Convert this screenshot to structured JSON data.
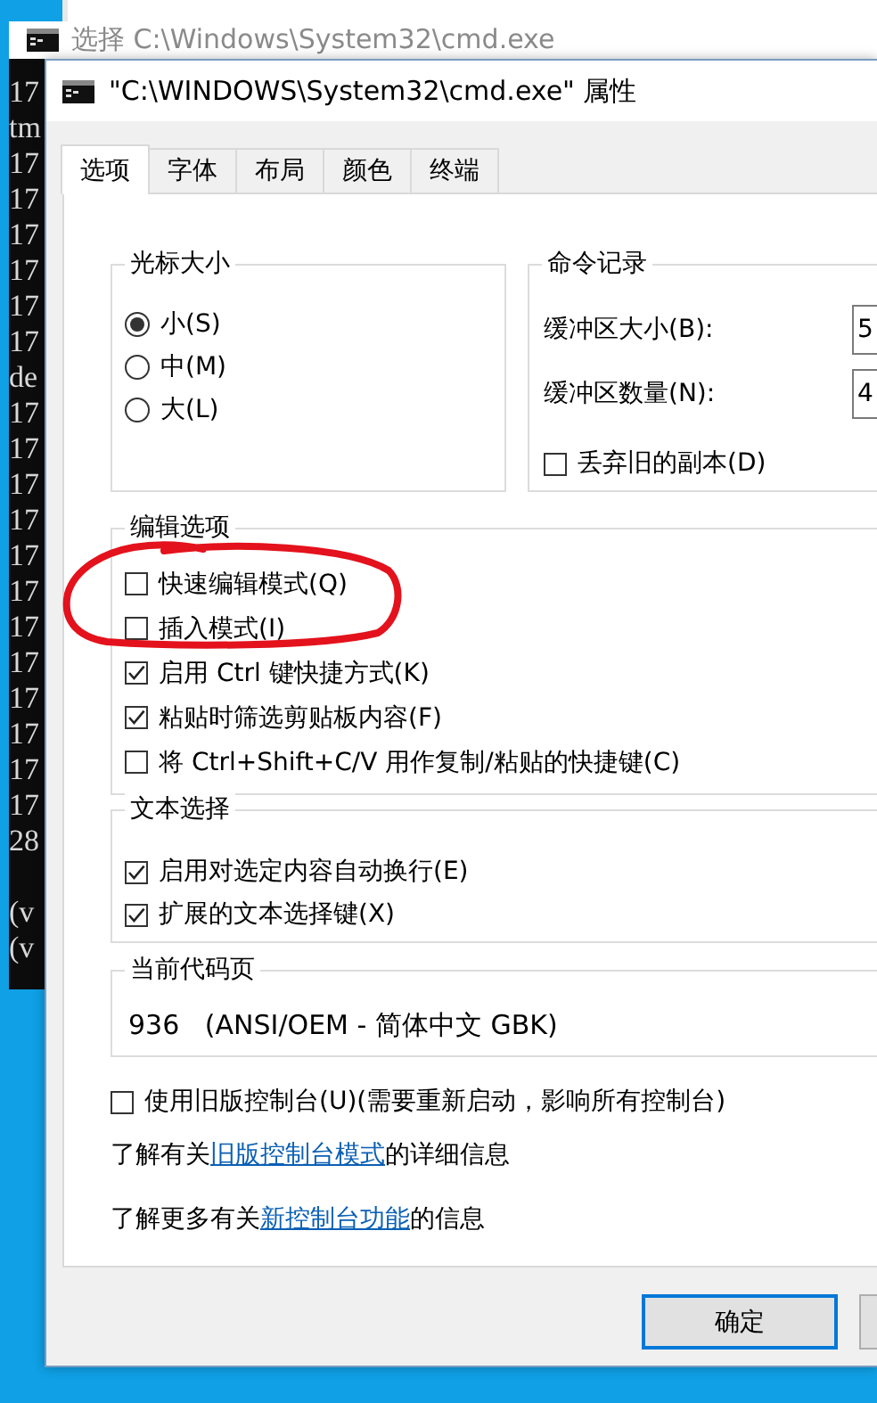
{
  "background_window": {
    "title": "选择 C:\\Windows\\System32\\cmd.exe",
    "lines": [
      "17",
      "tm",
      "17",
      "17",
      "17",
      "17",
      "17",
      "17",
      "de",
      "17",
      "17",
      "17",
      "17",
      "17",
      "17",
      "17",
      "17",
      "17",
      "17",
      "17",
      "17",
      "28"
    ],
    "lines_after_gap": [
      "(v",
      "(v"
    ]
  },
  "dialog": {
    "title": "\"C:\\WINDOWS\\System32\\cmd.exe\" 属性",
    "tabs": [
      {
        "label": "选项",
        "selected": true
      },
      {
        "label": "字体",
        "selected": false
      },
      {
        "label": "布局",
        "selected": false
      },
      {
        "label": "颜色",
        "selected": false
      },
      {
        "label": "终端",
        "selected": false
      }
    ],
    "cursor_size": {
      "title": "光标大小",
      "options": [
        {
          "label": "小(S)",
          "selected": true
        },
        {
          "label": "中(M)",
          "selected": false
        },
        {
          "label": "大(L)",
          "selected": false
        }
      ]
    },
    "command_history": {
      "title": "命令记录",
      "fields": [
        {
          "label": "缓冲区大小(B):",
          "value": "5"
        },
        {
          "label": "缓冲区数量(N):",
          "value": "4"
        }
      ],
      "discard_old_duplicates": {
        "label": "丢弃旧的副本(D)",
        "checked": false
      }
    },
    "edit_options": {
      "title": "编辑选项",
      "options": [
        {
          "label": "快速编辑模式(Q)",
          "checked": false
        },
        {
          "label": "插入模式(I)",
          "checked": false
        },
        {
          "label": "启用 Ctrl 键快捷方式(K)",
          "checked": true
        },
        {
          "label": "粘贴时筛选剪贴板内容(F)",
          "checked": true
        },
        {
          "label": "将 Ctrl+Shift+C/V 用作复制/粘贴的快捷键(C)",
          "checked": false
        }
      ]
    },
    "text_selection": {
      "title": "文本选择",
      "options": [
        {
          "label": "启用对选定内容自动换行(E)",
          "checked": true
        },
        {
          "label": "扩展的文本选择键(X)",
          "checked": true
        }
      ]
    },
    "code_page": {
      "title": "当前代码页",
      "value": "936   (ANSI/OEM - 简体中文 GBK)"
    },
    "legacy_console": {
      "label": "使用旧版控制台(U)(需要重新启动，影响所有控制台)",
      "checked": false
    },
    "info_links": [
      {
        "before": "了解有关",
        "link": "旧版控制台模式",
        "after": "的详细信息"
      },
      {
        "before": "了解更多有关",
        "link": "新控制台功能",
        "after": "的信息"
      }
    ],
    "buttons": [
      {
        "label": "确定",
        "default": true
      },
      {
        "default": false
      }
    ]
  },
  "annotation": {
    "kind": "hand_drawn_circle"
  }
}
